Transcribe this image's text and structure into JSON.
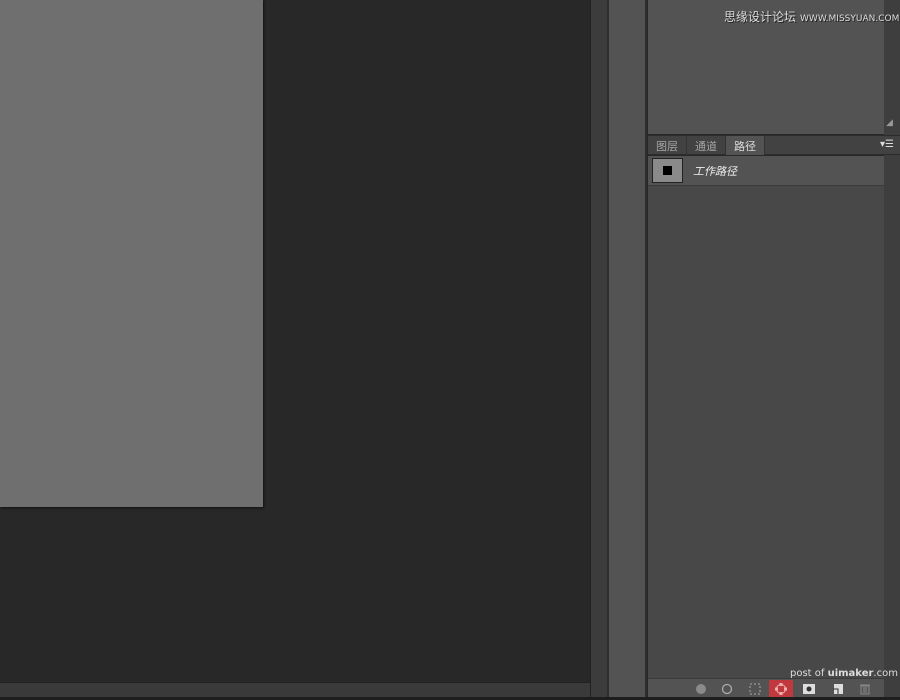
{
  "watermark": {
    "site_name": "思缘设计论坛",
    "url": "WWW.MISSYUAN.COM"
  },
  "panel": {
    "tabs": [
      {
        "label": "图层",
        "active": false
      },
      {
        "label": "通道",
        "active": false
      },
      {
        "label": "路径",
        "active": true
      }
    ],
    "menu_icon": "panel-menu-icon",
    "paths": [
      {
        "name": "工作路径"
      }
    ],
    "toolbar": [
      {
        "name": "fill-path-icon",
        "highlighted": false
      },
      {
        "name": "stroke-path-icon",
        "highlighted": false
      },
      {
        "name": "load-as-selection-icon",
        "highlighted": false
      },
      {
        "name": "make-work-path-icon",
        "highlighted": true
      },
      {
        "name": "add-mask-icon",
        "highlighted": false
      },
      {
        "name": "new-path-icon",
        "highlighted": false
      },
      {
        "name": "delete-path-icon",
        "highlighted": false
      }
    ],
    "highlight_color": "#c0393f"
  },
  "credit": {
    "prefix": "post of ",
    "brand": "uimaker",
    ".suffix": ".com",
    "suffix": ".com"
  }
}
